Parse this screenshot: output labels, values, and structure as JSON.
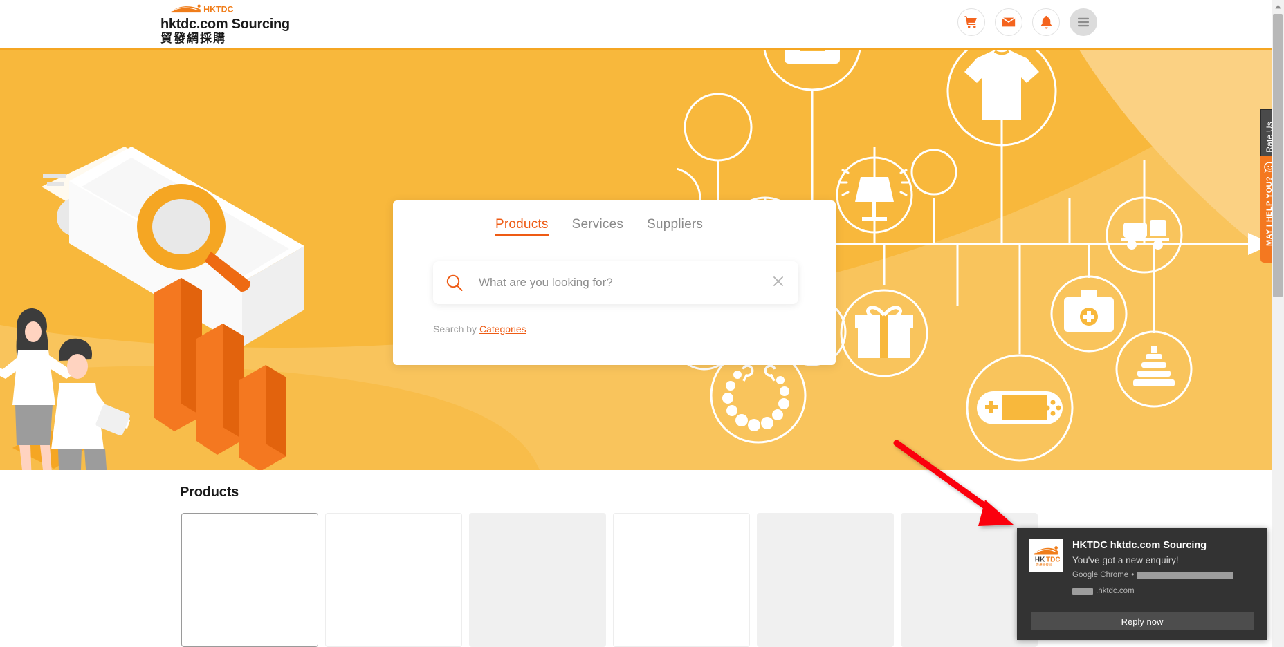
{
  "header": {
    "brand_en": "hktdc.com Sourcing",
    "brand_zh": "貿發網採購",
    "logo_text": "HKTDC",
    "icons": [
      {
        "name": "cart-icon",
        "label": "Shopping cart"
      },
      {
        "name": "mail-icon",
        "label": "Messages"
      },
      {
        "name": "bell-icon",
        "label": "Notifications"
      },
      {
        "name": "menu-icon",
        "label": "Menu"
      }
    ]
  },
  "search": {
    "tabs": [
      {
        "label": "Products",
        "active": true
      },
      {
        "label": "Services",
        "active": false
      },
      {
        "label": "Suppliers",
        "active": false
      }
    ],
    "placeholder": "What are you looking for?",
    "value": "",
    "search_by_prefix": "Search by",
    "search_by_link": "Categories"
  },
  "products": {
    "title": "Products",
    "cards": [
      {
        "style": "outlined"
      },
      {
        "style": "plain"
      },
      {
        "style": "filled"
      },
      {
        "style": "plain"
      },
      {
        "style": "filled"
      },
      {
        "style": "filled"
      }
    ]
  },
  "side_tabs": {
    "rate_us": "Rate Us",
    "help": "MAY I HELP YOU?"
  },
  "toast": {
    "app_title": "HKTDC hktdc.com Sourcing",
    "message": "You've got a new enquiry!",
    "source_app": "Google Chrome",
    "separator": "•",
    "url_suffix": ".hktdc.com",
    "reply_button": "Reply now"
  },
  "banner": {
    "category_icons": [
      "suitcase-icon",
      "tshirt-icon",
      "lamp-icon",
      "phone-icon",
      "truck-icon",
      "watch-icon",
      "gift-icon",
      "necklace-icon",
      "game-console-icon",
      "first-aid-icon",
      "toy-stack-icon"
    ]
  },
  "colors": {
    "brand_orange": "#ee5b14",
    "banner_yellow": "#f9c45c",
    "banner_yellow_dark": "#f8b83c",
    "header_rule": "#f5a623",
    "toast_bg": "#333333",
    "annotation_red": "#fb0007"
  }
}
